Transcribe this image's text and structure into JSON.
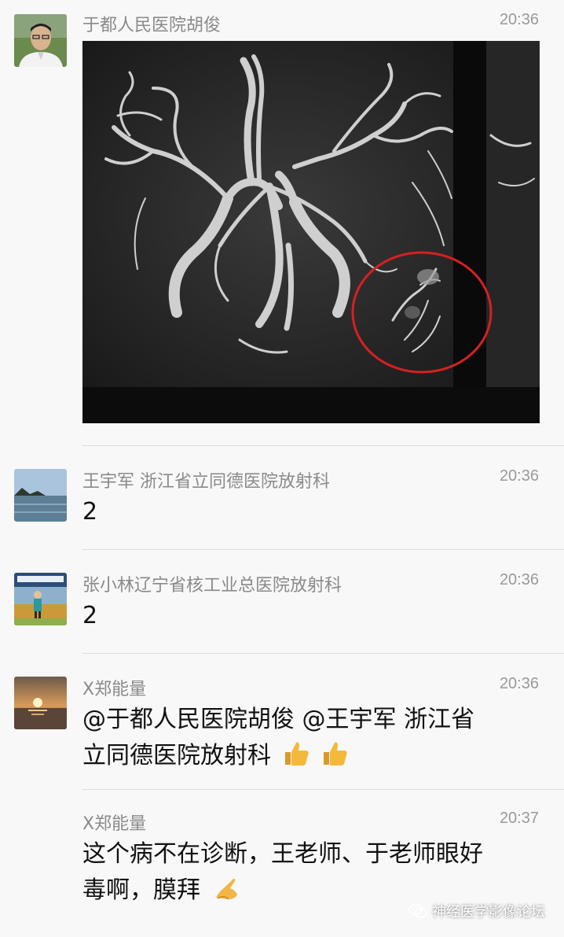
{
  "colors": {
    "background": "#f8f8f8",
    "sender_name": "#8a8a8a",
    "timestamp": "#9a9a9a",
    "divider": "#dcdcdc",
    "highlight_circle": "#d62020"
  },
  "messages": [
    {
      "sender": "于都人民医院胡俊",
      "time": "20:36",
      "avatar": "person-portrait-avatar",
      "content_type": "image",
      "image": "brain-angiography-scan"
    },
    {
      "sender": "王宇军 浙江省立同德医院放射科",
      "time": "20:36",
      "avatar": "lake-landscape-avatar",
      "text": "2"
    },
    {
      "sender": "张小林辽宁省核工业总医院放射科",
      "time": "20:36",
      "avatar": "person-outdoor-avatar",
      "text": "2"
    },
    {
      "sender": "X郑能量",
      "time": "20:36",
      "avatar": "sunset-avatar",
      "text_line1": "@于都人民医院胡俊 @王宇军 浙江省",
      "text_line2": "立同德医院放射科",
      "emoji": "thumbs-up-icon"
    },
    {
      "sender": "X郑能量",
      "time": "20:37",
      "text_line1": "这个病不在诊断，王老师、于老师眼好",
      "text_line2": "毒啊，膜拜",
      "emoji": "praying-hands-icon"
    }
  ],
  "watermark": {
    "text": "神经医学影像论坛",
    "icon": "wechat-icon"
  }
}
